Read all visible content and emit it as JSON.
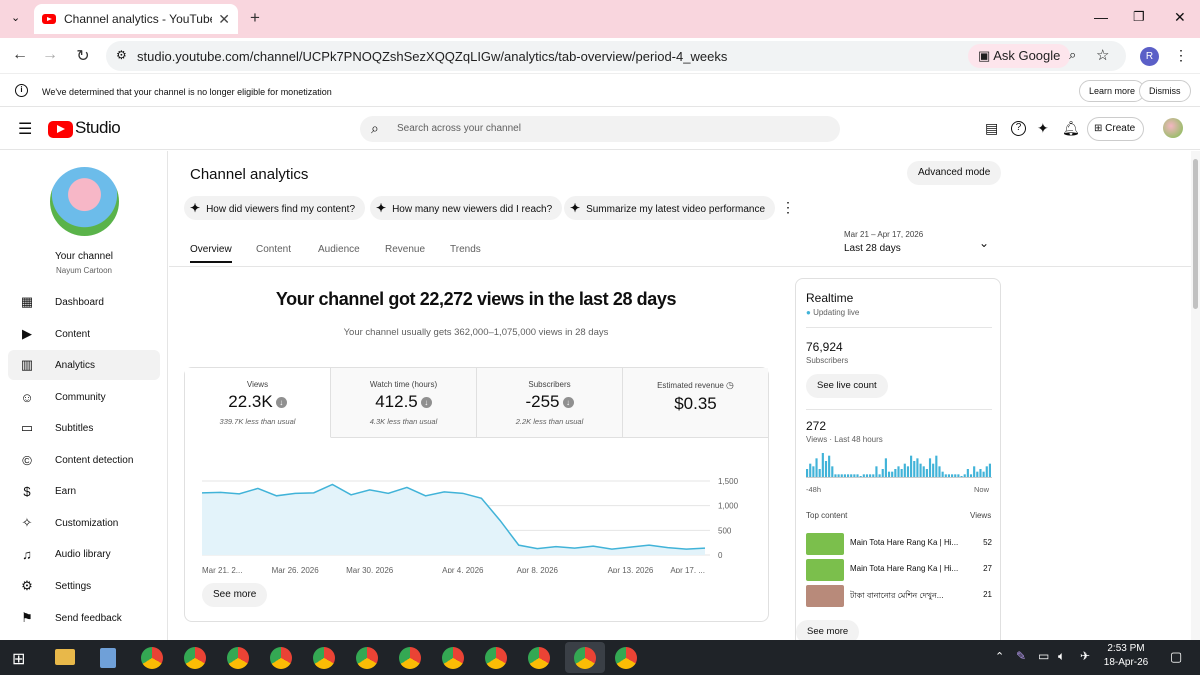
{
  "browser": {
    "tab_title": "Channel analytics - YouTube Stu",
    "new_tab": "+",
    "url": "studio.youtube.com/channel/UCPk7PNOQZshSezXQQZqLIGw/analytics/tab-overview/period-4_weeks",
    "ask_google": "Ask Google",
    "profile_initial": "R"
  },
  "infobar": {
    "message": "We've determined that your channel is no longer eligible for monetization",
    "learn_more": "Learn more",
    "dismiss": "Dismiss"
  },
  "header": {
    "logo_text": "Studio",
    "search_placeholder": "Search across your channel",
    "create_label": "Create"
  },
  "sidebar": {
    "channel_title": "Your channel",
    "channel_name": "Nayum Cartoon",
    "items": [
      {
        "label": "Dashboard",
        "icon": "dashboard-icon"
      },
      {
        "label": "Content",
        "icon": "content-icon"
      },
      {
        "label": "Analytics",
        "icon": "analytics-icon"
      },
      {
        "label": "Community",
        "icon": "community-icon"
      },
      {
        "label": "Subtitles",
        "icon": "subtitles-icon"
      },
      {
        "label": "Content detection",
        "icon": "copyright-icon"
      },
      {
        "label": "Earn",
        "icon": "dollar-icon"
      },
      {
        "label": "Customization",
        "icon": "magic-wand-icon"
      },
      {
        "label": "Audio library",
        "icon": "audio-library-icon"
      },
      {
        "label": "Settings",
        "icon": "gear-icon"
      },
      {
        "label": "Send feedback",
        "icon": "feedback-icon"
      }
    ]
  },
  "main": {
    "page_title": "Channel analytics",
    "advanced_mode": "Advanced mode",
    "suggestions": [
      "How did viewers find my content?",
      "How many new viewers did I reach?",
      "Summarize my latest video performance"
    ],
    "tabs": [
      "Overview",
      "Content",
      "Audience",
      "Revenue",
      "Trends"
    ],
    "date_range": "Mar 21 – Apr 17, 2026",
    "period": "Last 28 days",
    "headline": "Your channel got 22,272 views in the last 28 days",
    "subheadline": "Your channel usually gets 362,000–1,075,000 views in 28 days",
    "metrics": [
      {
        "label": "Views",
        "value": "22.3K",
        "sub": "339.7K less than usual"
      },
      {
        "label": "Watch time (hours)",
        "value": "412.5",
        "sub": "4.3K less than usual"
      },
      {
        "label": "Subscribers",
        "value": "-255",
        "sub": "2.2K less than usual"
      },
      {
        "label": "Estimated revenue",
        "value": "$0.35",
        "sub": ""
      }
    ],
    "see_more": "See more"
  },
  "chart_data": {
    "type": "area",
    "x": [
      "Mar 21",
      "Mar 22",
      "Mar 23",
      "Mar 24",
      "Mar 25",
      "Mar 26",
      "Mar 27",
      "Mar 28",
      "Mar 29",
      "Mar 30",
      "Mar 31",
      "Apr 1",
      "Apr 2",
      "Apr 3",
      "Apr 4",
      "Apr 5",
      "Apr 6",
      "Apr 7",
      "Apr 8",
      "Apr 9",
      "Apr 10",
      "Apr 11",
      "Apr 12",
      "Apr 13",
      "Apr 14",
      "Apr 15",
      "Apr 16",
      "Apr 17"
    ],
    "values": [
      1260,
      1270,
      1240,
      1350,
      1200,
      1250,
      1260,
      1430,
      1220,
      1320,
      1250,
      1370,
      1200,
      1280,
      1250,
      1150,
      700,
      200,
      130,
      170,
      140,
      180,
      120,
      160,
      200,
      150,
      120,
      140
    ],
    "x_tick_labels": [
      "Mar 21, 2...",
      "Mar 26, 2026",
      "Mar 30, 2026",
      "Apr 4, 2026",
      "Apr 8, 2026",
      "Apr 13, 2026",
      "Apr 17, ..."
    ],
    "y_ticks": [
      "1,500",
      "1,000",
      "500",
      "0"
    ],
    "ylim": [
      0,
      1500
    ],
    "grid": true,
    "color": "#41b3d8"
  },
  "realtime": {
    "title": "Realtime",
    "status": "Updating live",
    "subscribers": "76,924",
    "subscribers_label": "Subscribers",
    "see_live": "See live count",
    "views": "272",
    "views_label": "Views · Last 48 hours",
    "bars": [
      3,
      5,
      4,
      7,
      3,
      9,
      6,
      8,
      4,
      1,
      1,
      1,
      1,
      1,
      1,
      1,
      1,
      0,
      1,
      1,
      1,
      1,
      4,
      1,
      3,
      7,
      2,
      2,
      3,
      4,
      3,
      5,
      4,
      8,
      6,
      7,
      5,
      4,
      3,
      7,
      5,
      8,
      4,
      2,
      1,
      1,
      1,
      1,
      1,
      0,
      1,
      3,
      1,
      4,
      2,
      3,
      2,
      4,
      5
    ],
    "left_label": "-48h",
    "right_label": "Now",
    "top_content": "Top content",
    "views_col": "Views",
    "items": [
      {
        "name": "Main Tota Hare Rang Ka | Hi...",
        "views": "52"
      },
      {
        "name": "Main Tota Hare Rang Ka | Hi...",
        "views": "27"
      },
      {
        "name": "টাকা বানানোর মেশিন দেখুন...",
        "views": "21"
      }
    ],
    "see_more": "See more"
  },
  "taskbar": {
    "time": "2:53 PM",
    "date": "18-Apr-26"
  }
}
